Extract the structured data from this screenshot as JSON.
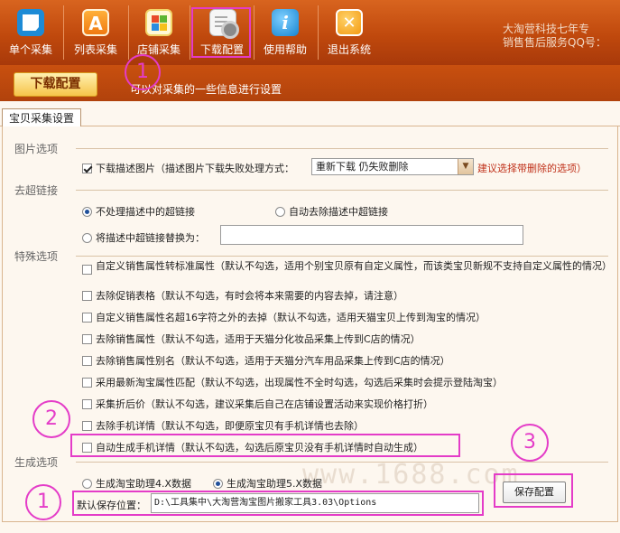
{
  "toolbar": {
    "buttons": [
      {
        "label": "单个采集",
        "icon": "q-logo-icon"
      },
      {
        "label": "列表采集",
        "icon": "a-logo-icon"
      },
      {
        "label": "店铺采集",
        "icon": "windows-icon"
      },
      {
        "label": "下载配置",
        "icon": "doc-settings-icon"
      },
      {
        "label": "使用帮助",
        "icon": "info-icon"
      },
      {
        "label": "退出系统",
        "icon": "exit-icon"
      }
    ],
    "company_line1": "大淘营科技七年专",
    "company_line2": "销售售后服务QQ号："
  },
  "subheader": {
    "tab": "下载配置",
    "description": "可以对采集的一些信息进行设置"
  },
  "panel": {
    "tab": "宝贝采集设置",
    "section_image": "图片选项",
    "download_images_label": "下载描述图片（描述图片下载失败处理方式：",
    "failure_select_value": "重新下载 仍失败删除",
    "recommend_link": "建议选择带删除的选项）",
    "section_hyperlinks": "去超链接",
    "radio_no_process": "不处理描述中的超链接",
    "radio_auto_remove": "自动去除描述中超链接",
    "radio_replace": "将描述中超链接替换为：",
    "replace_value": "",
    "section_special": "特殊选项",
    "options": [
      {
        "label": "自定义销售属性转标准属性（默认不勾选，适用个别宝贝原有自定义属性，而该类宝贝新规不支持自定义属性的情况）",
        "checked": false
      },
      {
        "label": "去除促销表格（默认不勾选，有时会将本来需要的内容去掉，请注意）",
        "checked": false
      },
      {
        "label": "自定义销售属性名超16字符之外的去掉（默认不勾选，适用天猫宝贝上传到淘宝的情况）",
        "checked": false
      },
      {
        "label": "去除销售属性（默认不勾选，适用于天猫分化妆品采集上传到C店的情况）",
        "checked": false
      },
      {
        "label": "去除销售属性别名（默认不勾选，适用于天猫分汽车用品采集上传到C店的情况）",
        "checked": false
      },
      {
        "label": "采用最新淘宝属性匹配（默认不勾选，出现属性不全时勾选，勾选后采集时会提示登陆淘宝）",
        "checked": false
      },
      {
        "label": "采集折后价（默认不勾选，建议采集后自己在店铺设置活动来实现价格打折）",
        "checked": false
      },
      {
        "label": "去除手机详情（默认不勾选，即便原宝贝有手机详情也去除）",
        "checked": false
      },
      {
        "label": "自动生成手机详情（默认不勾选，勾选后原宝贝没有手机详情时自动生成）",
        "checked": false
      }
    ],
    "section_generate": "生成选项",
    "radio_assist4": "生成淘宝助理4.X数据",
    "radio_assist5": "生成淘宝助理5.X数据",
    "save_path_label": "默认保存位置：",
    "save_path_value": "D:\\工具集中\\大淘营淘宝图片搬家工具3.03\\Options",
    "save_button": "保存配置",
    "watermark": "www.1688.com"
  },
  "annotations": [
    "1",
    "1",
    "2",
    "3"
  ],
  "colors": {
    "toolbar": "#c0490d",
    "highlight": "#e43cc8",
    "link": "#c0311a"
  }
}
